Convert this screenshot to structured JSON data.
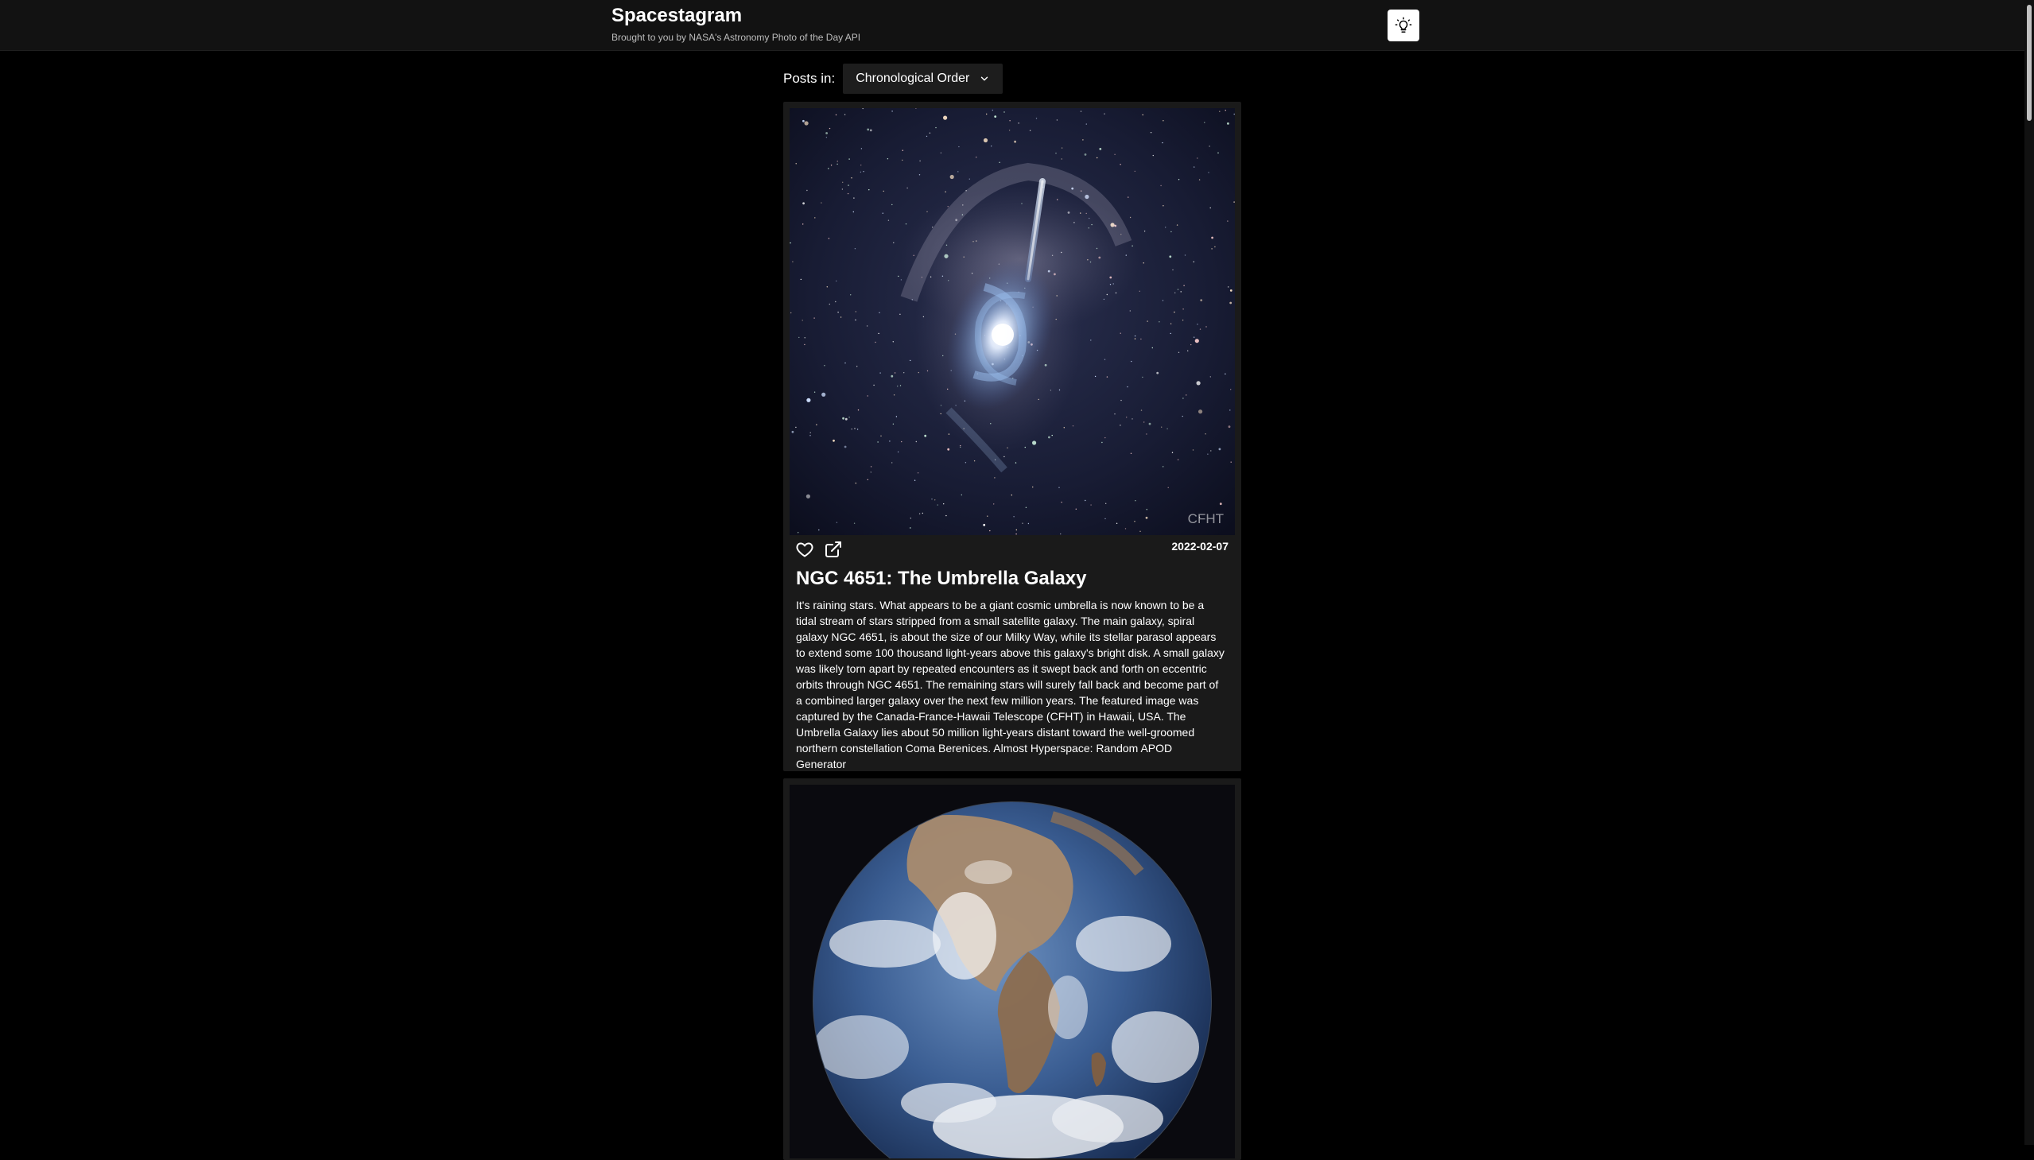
{
  "header": {
    "title": "Spacestagram",
    "subtitle": "Brought to you by NASA's Astronomy Photo of the Day API",
    "theme_toggle_icon": "lightbulb-icon"
  },
  "sort": {
    "label": "Posts in:",
    "selected": "Chronological Order"
  },
  "posts": [
    {
      "image_credit": "CFHT",
      "date": "2022-02-07",
      "title": "NGC 4651: The Umbrella Galaxy",
      "description": "It's raining stars. What appears to be a giant cosmic umbrella is now known to be a tidal stream of stars stripped from a small satellite galaxy. The main galaxy, spiral galaxy NGC 4651, is about the size of our Milky Way, while its stellar parasol appears to extend some 100 thousand light-years above this galaxy's bright disk. A small galaxy was likely torn apart by repeated encounters as it swept back and forth on eccentric orbits through NGC 4651. The remaining stars will surely fall back and become part of a combined larger galaxy over the next few million years. The featured image was captured by the Canada-France-Hawaii Telescope (CFHT) in Hawaii, USA. The Umbrella Galaxy lies about 50 million light-years distant toward the well-groomed northern constellation Coma Berenices. Almost Hyperspace: Random APOD Generator",
      "icons": [
        "heart-icon",
        "external-link-icon"
      ]
    },
    {
      "image_subject": "earth"
    }
  ],
  "colors": {
    "page_bg": "#000000",
    "header_bg": "#121212",
    "card_bg": "#1a1a1a",
    "select_bg": "#1d1d1d"
  }
}
